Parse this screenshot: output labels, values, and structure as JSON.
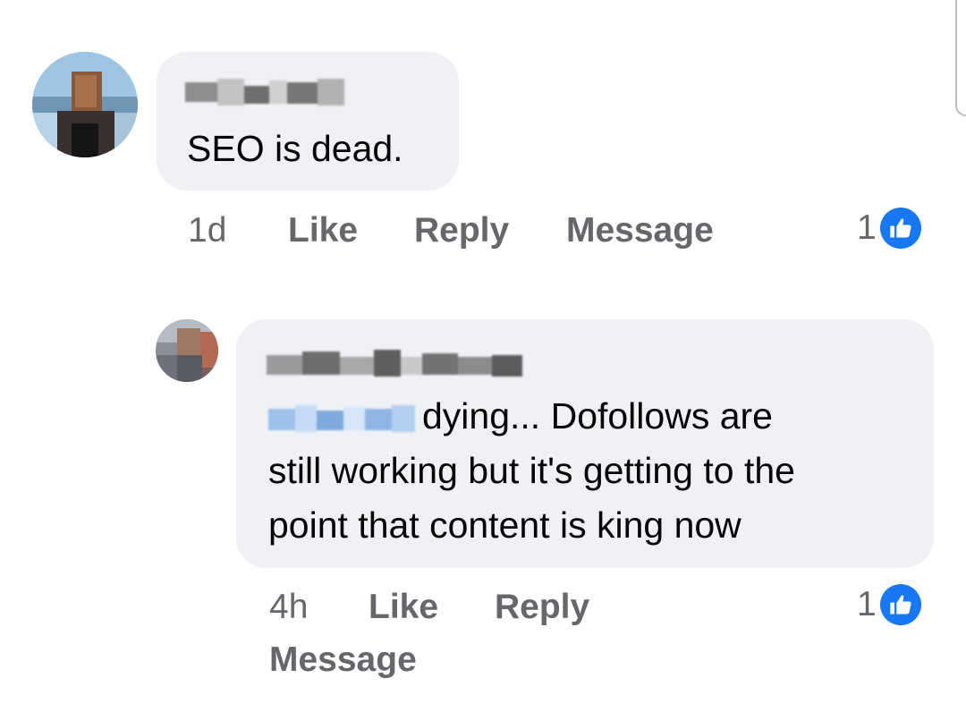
{
  "comments": [
    {
      "author": "",
      "text": "SEO is dead.",
      "time": "1d",
      "actions": [
        "Like",
        "Reply",
        "Message"
      ],
      "reaction_count": "1",
      "reaction_icon": "thumbs-up-icon"
    },
    {
      "author": "",
      "mention": "",
      "text_lines": [
        "dying... Dofollows are",
        "still working but it's getting to the",
        "point that content is king now"
      ],
      "time": "4h",
      "actions": [
        "Like",
        "Reply",
        "Message"
      ],
      "reaction_count": "1",
      "reaction_icon": "thumbs-up-icon"
    }
  ],
  "colors": {
    "bubble": "#eff1f4",
    "action_text": "#65676b",
    "like_badge": "#1877f2"
  }
}
